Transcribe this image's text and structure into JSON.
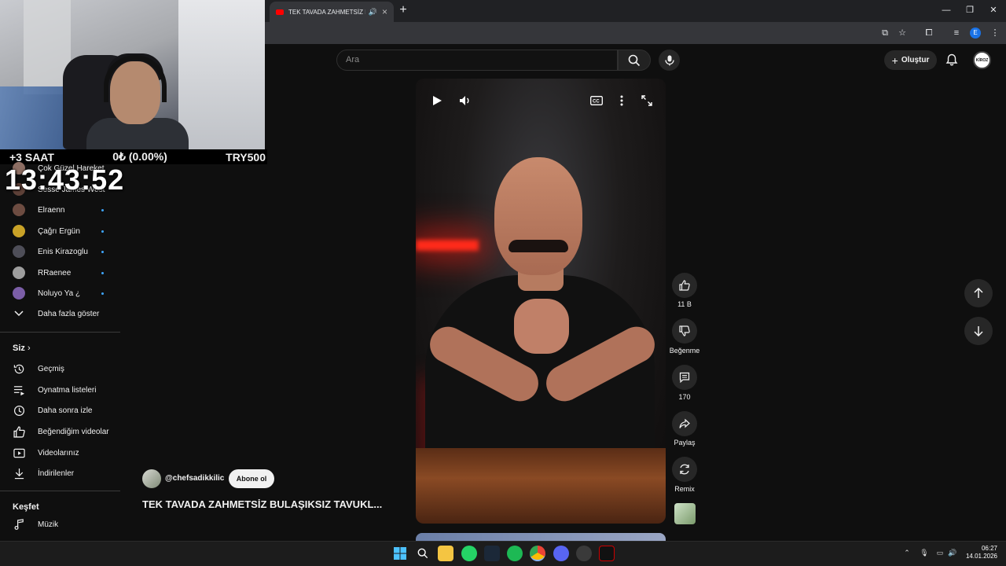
{
  "overlay": {
    "timezone": "+3 SAAT",
    "balance": "0₺ (0.00%)",
    "goal": "TRY500",
    "clock": "13:43:52"
  },
  "browser": {
    "tab_title": "TEK TAVADA ZAHMETSİZ BU",
    "new_tab_label": "+",
    "profile_initial": "E"
  },
  "header": {
    "search_placeholder": "Ara",
    "create_label": "Oluştur",
    "avatar_text": "KİROZ"
  },
  "sidebar": {
    "subscriptions": [
      {
        "label": "Çok Güzel Hareket",
        "color": "#8d6e63",
        "dot": false
      },
      {
        "label": "Sesse James West",
        "color": "#5d4037",
        "dot": false
      },
      {
        "label": "Elraenn",
        "color": "#6d4c41",
        "dot": true
      },
      {
        "label": "Çağrı Ergün",
        "color": "#c9a227",
        "dot": true
      },
      {
        "label": "Enis Kirazoglu",
        "color": "#4e4e58",
        "dot": true
      },
      {
        "label": "RRaenee",
        "color": "#9e9e9e",
        "dot": true
      },
      {
        "label": "Noluyo Ya ¿",
        "color": "#7b5ea7",
        "dot": true
      }
    ],
    "show_more": "Daha fazla göster",
    "you_heading": "Siz",
    "you_items": [
      {
        "label": "Geçmiş",
        "icon": "history-icon"
      },
      {
        "label": "Oynatma listeleri",
        "icon": "playlist-icon"
      },
      {
        "label": "Daha sonra izle",
        "icon": "watch-later-icon"
      },
      {
        "label": "Beğendiğim videolar",
        "icon": "like-icon"
      },
      {
        "label": "Videolarınız",
        "icon": "your-videos-icon"
      },
      {
        "label": "İndirilenler",
        "icon": "download-icon"
      }
    ],
    "explore_heading": "Keşfet",
    "explore_items": [
      {
        "label": "Müzik",
        "icon": "music-icon"
      }
    ]
  },
  "short": {
    "channel_handle": "@chefsadikkilic",
    "subscribe_label": "Abone ol",
    "title": "TEK TAVADA ZAHMETSİZ BULAŞIKSIZ TAVUKL...",
    "likes": "11 B",
    "dislike_label": "Beğenme",
    "comments": "170",
    "share_label": "Paylaş",
    "remix_label": "Remix"
  },
  "taskbar": {
    "time": "06:27",
    "date": "14.01.2026"
  }
}
